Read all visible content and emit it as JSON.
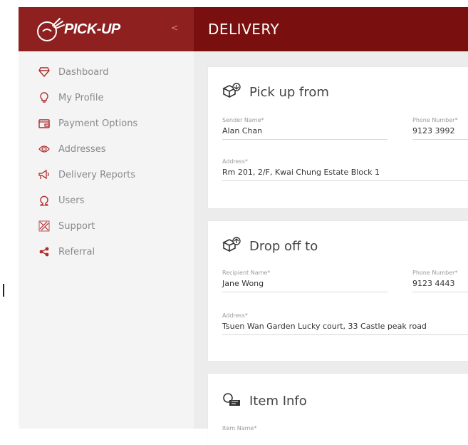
{
  "brand": {
    "name": "PICK-UP",
    "collapse_glyph": "<"
  },
  "header": {
    "title": "DELIVERY"
  },
  "sidebar": {
    "items": [
      {
        "label": "Dashboard",
        "icon": "diamond-icon"
      },
      {
        "label": "My Profile",
        "icon": "lightbulb-icon"
      },
      {
        "label": "Payment Options",
        "icon": "wallet-icon"
      },
      {
        "label": "Addresses",
        "icon": "eye-icon"
      },
      {
        "label": "Delivery Reports",
        "icon": "megaphone-icon"
      },
      {
        "label": "Users",
        "icon": "omega-icon"
      },
      {
        "label": "Support",
        "icon": "support-icon"
      },
      {
        "label": "Referral",
        "icon": "share-icon"
      }
    ]
  },
  "pickup": {
    "title": "Pick up from",
    "sender_label": "Sender Name*",
    "sender_value": "Alan Chan",
    "phone_label": "Phone Number*",
    "phone_value": "9123 3992",
    "address_label": "Address*",
    "address_value": "Rm 201, 2/F, Kwai Chung Estate Block 1"
  },
  "dropoff": {
    "title": "Drop off to",
    "recipient_label": "Recipient Name*",
    "recipient_value": "Jane Wong",
    "phone_label": "Phone Number*",
    "phone_value": "9123 4443",
    "address_label": "Address*",
    "address_value": "Tsuen Wan Garden Lucky court, 33 Castle peak road"
  },
  "item": {
    "title": "Item Info",
    "name_label": "Item Name*"
  },
  "colors": {
    "logo_bg": "#8e2020",
    "header_bg": "#7a0f0f",
    "accent": "#b02a2a"
  }
}
